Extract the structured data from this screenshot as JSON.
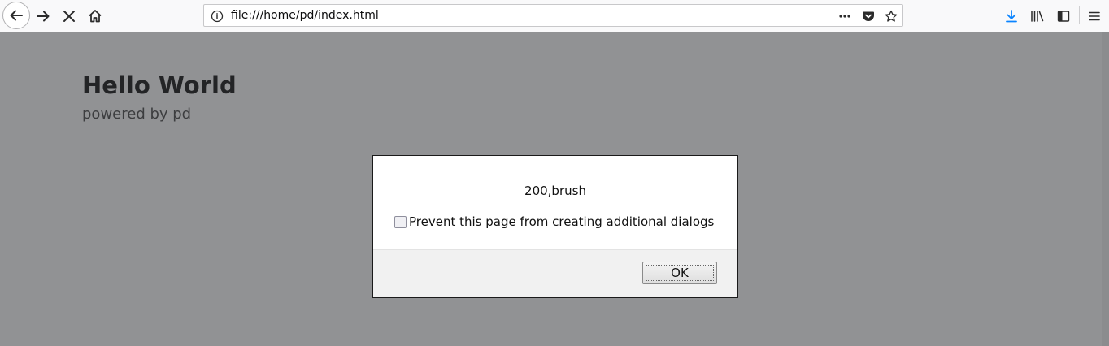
{
  "toolbar": {
    "url": "file:///home/pd/index.html",
    "icons": {
      "back": "back-arrow-icon",
      "forward": "forward-arrow-icon",
      "stop": "stop-icon",
      "home": "home-icon",
      "info": "info-icon",
      "more": "more-actions-icon",
      "pocket": "pocket-icon",
      "bookmark": "star-icon",
      "downloads": "download-icon",
      "library": "library-icon",
      "sidebar": "sidebar-icon",
      "menu": "hamburger-menu-icon"
    },
    "accent_color": "#0a84ff"
  },
  "page": {
    "title": "Hello World",
    "subtitle": "powered by pd"
  },
  "dialog": {
    "message": "200,brush",
    "checkbox_label": "Prevent this page from creating additional dialogs",
    "checkbox_checked": false,
    "ok_label": "OK"
  }
}
